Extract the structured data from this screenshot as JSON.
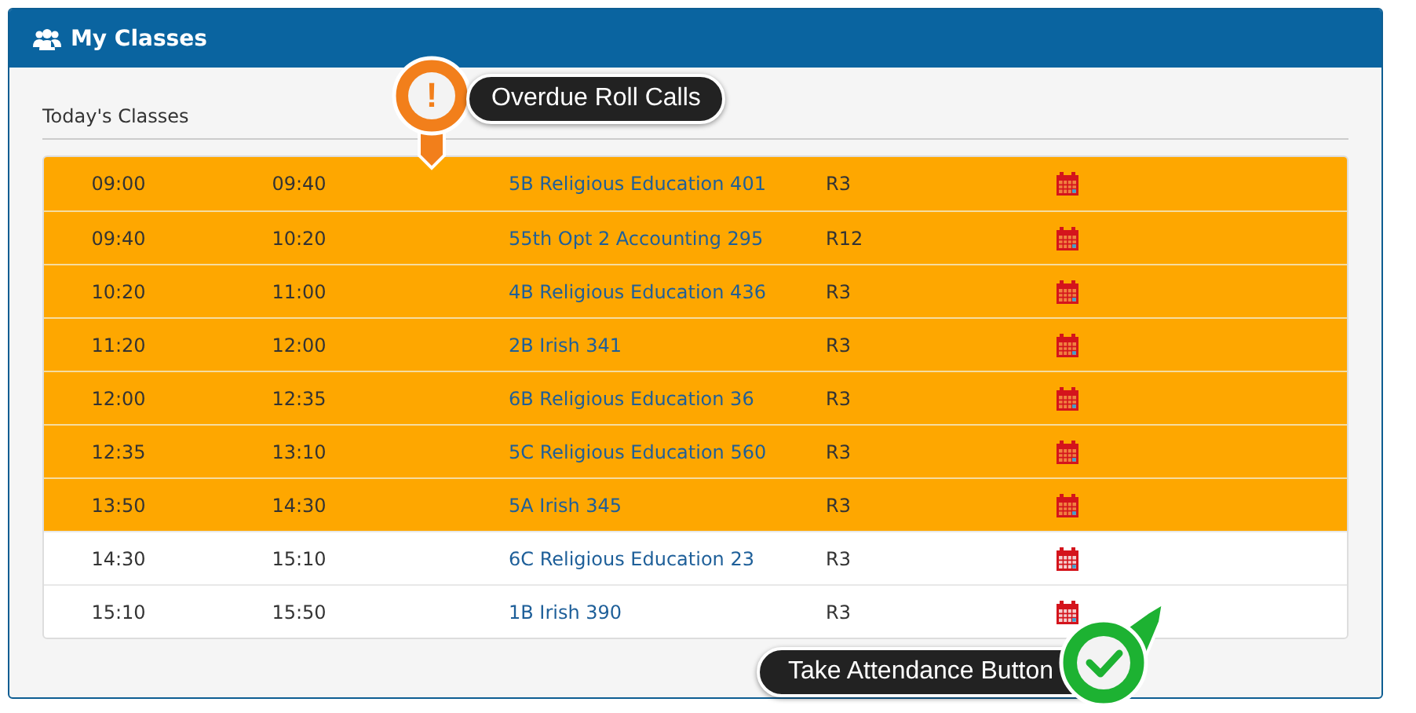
{
  "panel": {
    "title": "My Classes"
  },
  "section_title": "Today's Classes",
  "rows": [
    {
      "start": "09:00",
      "end": "09:40",
      "class": "5B Religious Education 401",
      "room": "R3",
      "overdue": true
    },
    {
      "start": "09:40",
      "end": "10:20",
      "class": "55th Opt 2 Accounting 295",
      "room": "R12",
      "overdue": true
    },
    {
      "start": "10:20",
      "end": "11:00",
      "class": "4B Religious Education 436",
      "room": "R3",
      "overdue": true
    },
    {
      "start": "11:20",
      "end": "12:00",
      "class": "2B Irish 341",
      "room": "R3",
      "overdue": true
    },
    {
      "start": "12:00",
      "end": "12:35",
      "class": "6B Religious Education 36",
      "room": "R3",
      "overdue": true
    },
    {
      "start": "12:35",
      "end": "13:10",
      "class": "5C Religious Education 560",
      "room": "R3",
      "overdue": true
    },
    {
      "start": "13:50",
      "end": "14:30",
      "class": "5A Irish 345",
      "room": "R3",
      "overdue": true
    },
    {
      "start": "14:30",
      "end": "15:10",
      "class": "6C Religious Education 23",
      "room": "R3",
      "overdue": false
    },
    {
      "start": "15:10",
      "end": "15:50",
      "class": "1B Irish 390",
      "room": "R3",
      "overdue": false
    }
  ],
  "callouts": [
    {
      "kind": "warning",
      "symbol": "!",
      "text": "Overdue Roll Calls"
    },
    {
      "kind": "check",
      "text": "Take Attendance Button"
    }
  ]
}
